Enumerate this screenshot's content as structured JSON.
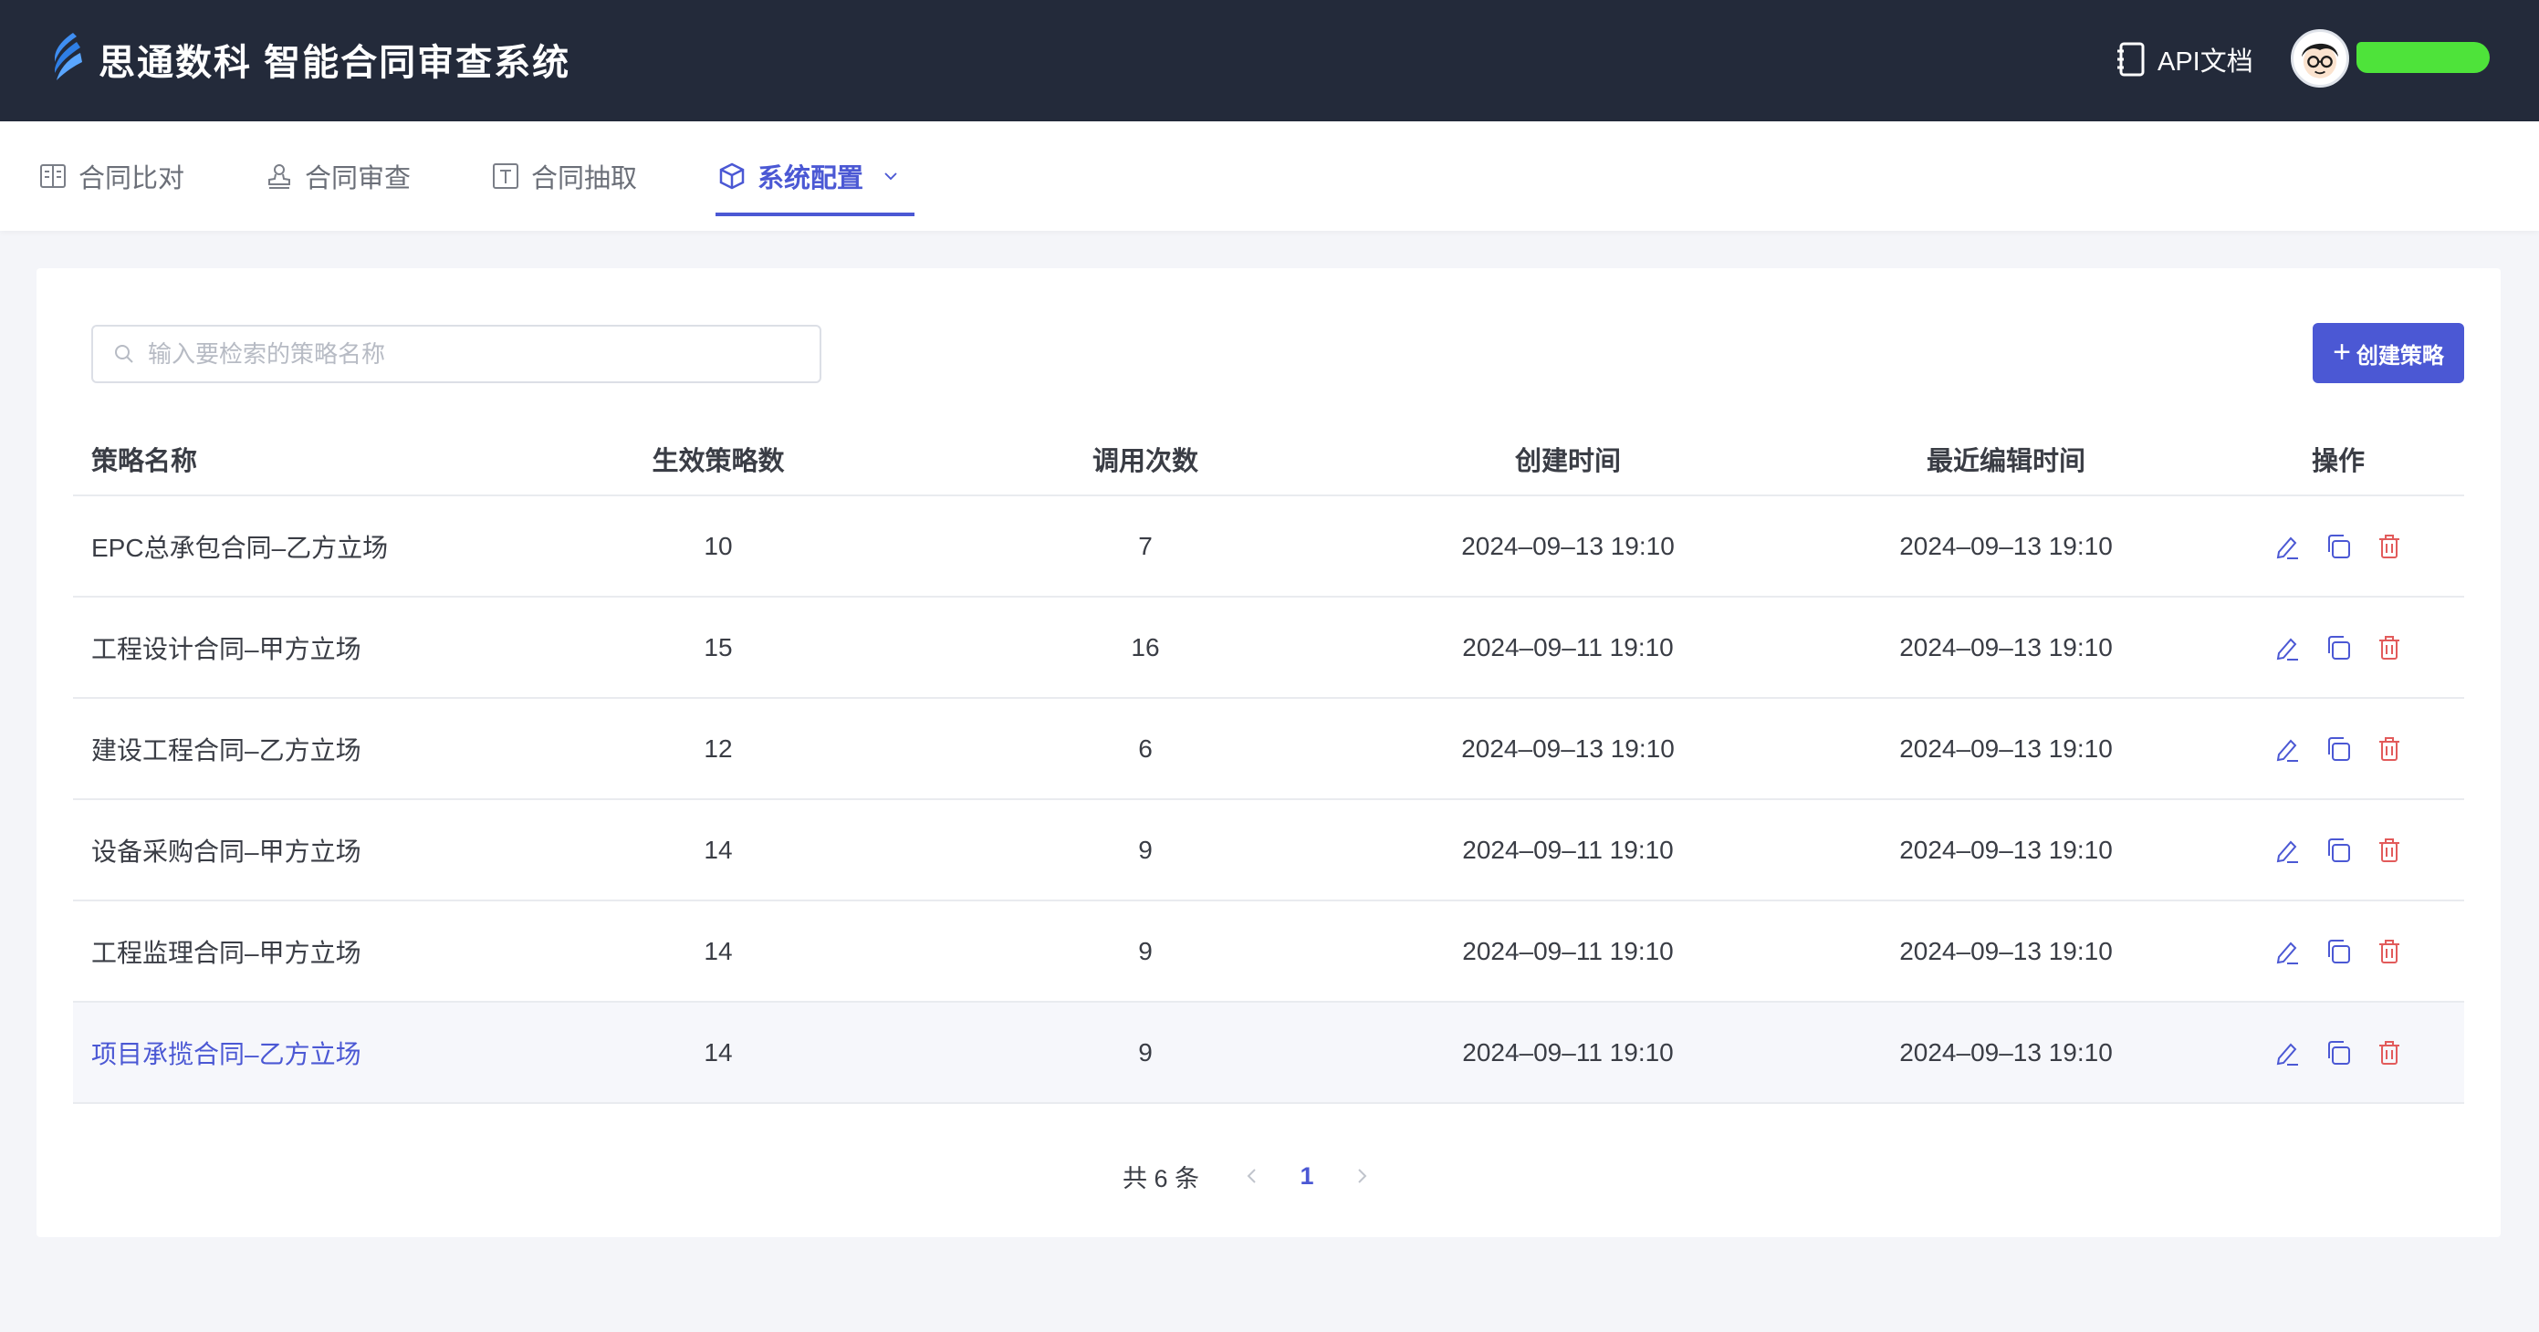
{
  "header": {
    "app_title": "思通数科 智能合同审查系统",
    "api_doc_label": "API文档",
    "colors": {
      "bar": "#232a3a",
      "accent": "#4b58d4"
    }
  },
  "nav": {
    "items": [
      {
        "label": "合同比对",
        "icon": "compare-doc-icon"
      },
      {
        "label": "合同审查",
        "icon": "stamp-icon"
      },
      {
        "label": "合同抽取",
        "icon": "text-extract-icon"
      },
      {
        "label": "系统配置",
        "icon": "box-config-icon",
        "active": true
      }
    ]
  },
  "search": {
    "placeholder": "输入要检索的策略名称",
    "value": ""
  },
  "create_button": {
    "label": "创建策略"
  },
  "table": {
    "columns": [
      "策略名称",
      "生效策略数",
      "调用次数",
      "创建时间",
      "最近编辑时间",
      "操作"
    ],
    "rows": [
      {
        "name": "EPC总承包合同–乙方立场",
        "effective": "10",
        "calls": "7",
        "created": "2024–09–13 19:10",
        "edited": "2024–09–13 19:10"
      },
      {
        "name": "工程设计合同–甲方立场",
        "effective": "15",
        "calls": "16",
        "created": "2024–09–11 19:10",
        "edited": "2024–09–13 19:10"
      },
      {
        "name": "建设工程合同–乙方立场",
        "effective": "12",
        "calls": "6",
        "created": "2024–09–13 19:10",
        "edited": "2024–09–13 19:10"
      },
      {
        "name": "设备采购合同–甲方立场",
        "effective": "14",
        "calls": "9",
        "created": "2024–09–11 19:10",
        "edited": "2024–09–13 19:10"
      },
      {
        "name": "工程监理合同–甲方立场",
        "effective": "14",
        "calls": "9",
        "created": "2024–09–11 19:10",
        "edited": "2024–09–13 19:10"
      },
      {
        "name": "项目承揽合同–乙方立场",
        "effective": "14",
        "calls": "9",
        "created": "2024–09–11 19:10",
        "edited": "2024–09–13 19:10"
      }
    ]
  },
  "pagination": {
    "total_text": "共 6 条",
    "current_page": "1"
  }
}
